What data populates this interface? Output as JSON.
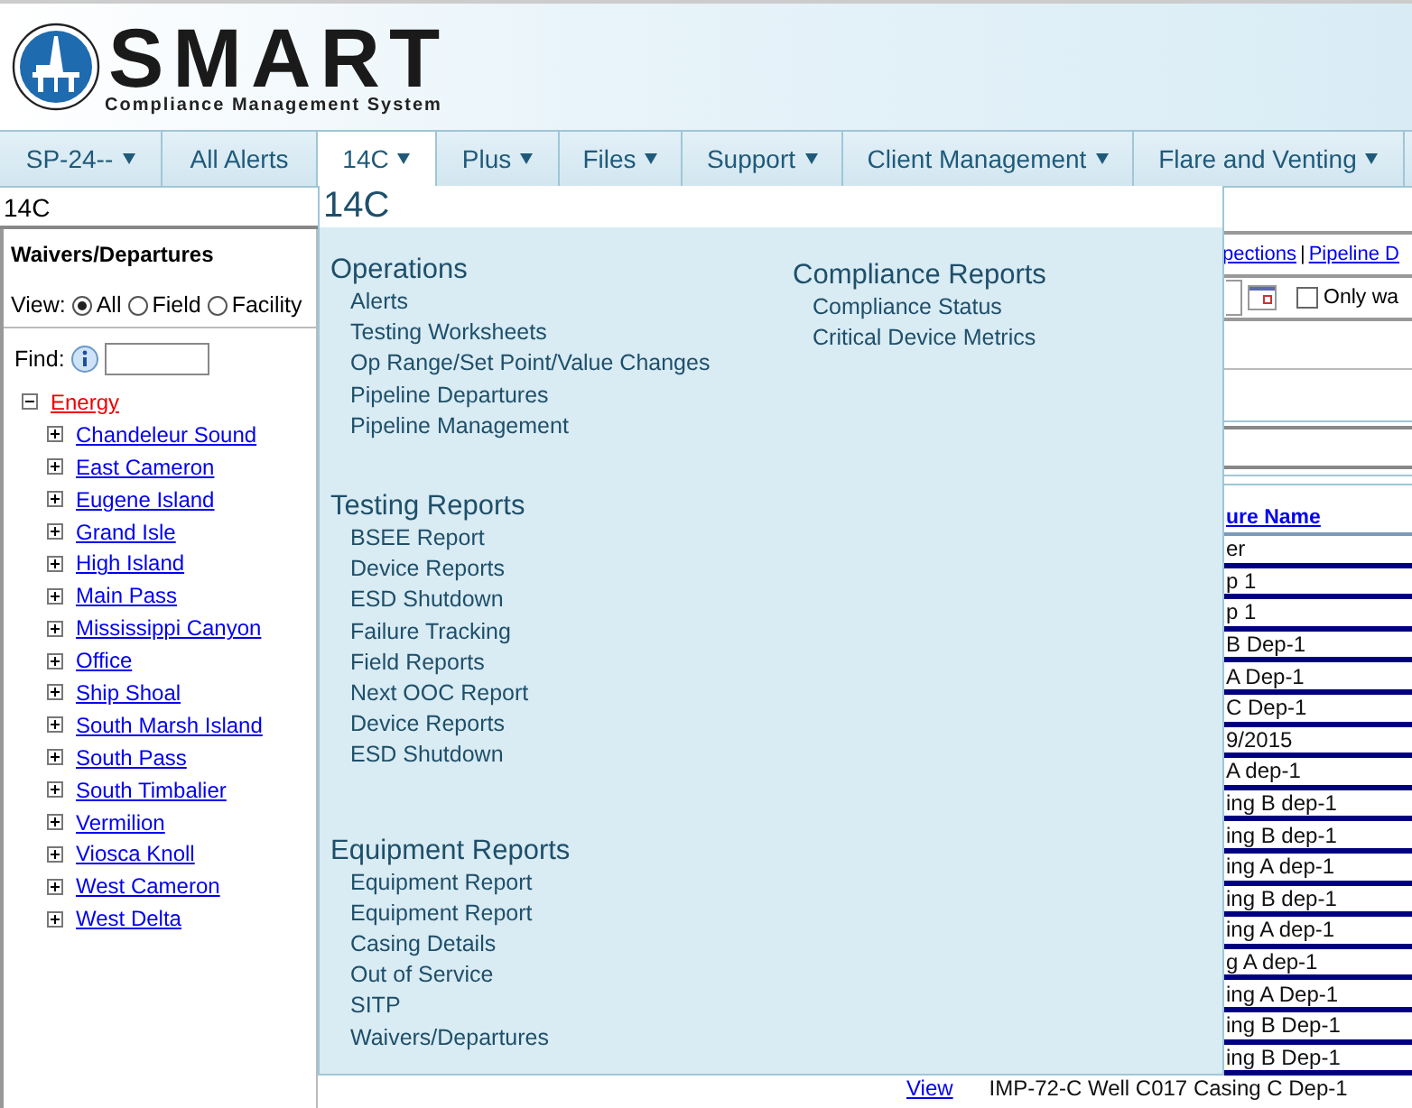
{
  "logo": {
    "title": "SMART",
    "subtitle": "Compliance Management System"
  },
  "nav": [
    {
      "label": "SP-24--",
      "dropdown": true,
      "selected": false
    },
    {
      "label": "All Alerts",
      "dropdown": false,
      "selected": false
    },
    {
      "label": "14C",
      "dropdown": true,
      "selected": true
    },
    {
      "label": "Plus",
      "dropdown": true,
      "selected": false
    },
    {
      "label": "Files",
      "dropdown": true,
      "selected": false
    },
    {
      "label": "Support",
      "dropdown": true,
      "selected": false
    },
    {
      "label": "Client Management",
      "dropdown": true,
      "selected": false
    },
    {
      "label": "Flare and Venting",
      "dropdown": true,
      "selected": false
    }
  ],
  "breadcrumb": "14C",
  "sidebar": {
    "title": "Waivers/Departures",
    "view_label": "View:",
    "view_options": [
      {
        "label": "All",
        "selected": true
      },
      {
        "label": "Field",
        "selected": false
      },
      {
        "label": "Facility",
        "selected": false
      }
    ],
    "find_label": "Find:",
    "tree": [
      {
        "label": "Energy",
        "expanded": true,
        "selected": true,
        "children": [
          {
            "label": "Chandeleur Sound",
            "expanded": false,
            "selected": false
          },
          {
            "label": "East Cameron",
            "expanded": false,
            "selected": false
          },
          {
            "label": "Eugene Island",
            "expanded": false,
            "selected": false
          },
          {
            "label": "Grand Isle",
            "expanded": false,
            "selected": false
          },
          {
            "label": "High Island",
            "expanded": false,
            "selected": false
          },
          {
            "label": "Main Pass",
            "expanded": false,
            "selected": false
          },
          {
            "label": "Mississippi Canyon",
            "expanded": false,
            "selected": false
          },
          {
            "label": "Office",
            "expanded": false,
            "selected": false
          },
          {
            "label": "Ship Shoal",
            "expanded": false,
            "selected": false
          },
          {
            "label": "South Marsh Island",
            "expanded": false,
            "selected": false
          },
          {
            "label": "South Pass",
            "expanded": false,
            "selected": false
          },
          {
            "label": "South Timbalier",
            "expanded": false,
            "selected": false
          },
          {
            "label": "Vermilion",
            "expanded": false,
            "selected": false
          },
          {
            "label": "Viosca Knoll",
            "expanded": false,
            "selected": false
          },
          {
            "label": "West Cameron",
            "expanded": false,
            "selected": false
          },
          {
            "label": "West Delta",
            "expanded": false,
            "selected": false
          }
        ]
      }
    ]
  },
  "menu": {
    "title": "14C",
    "columns": [
      [
        {
          "heading": "Operations",
          "items": [
            "Alerts",
            "Testing Worksheets",
            "Op Range/Set Point/Value Changes",
            "Pipeline Departures",
            "Pipeline Management"
          ]
        },
        {
          "heading": "Testing Reports",
          "items": [
            "BSEE Report",
            "Device Reports",
            "ESD Shutdown",
            "Failure Tracking",
            "Field Reports",
            "Next OOC Report",
            "Device Reports",
            "ESD Shutdown"
          ]
        },
        {
          "heading": "Equipment Reports",
          "items": [
            "Equipment Report",
            "Equipment Report",
            "Casing Details",
            "Out of Service",
            "SITP",
            "Waivers/Departures"
          ]
        }
      ],
      [
        {
          "heading": "Compliance Reports",
          "items": [
            "Compliance Status",
            "Critical Device Metrics"
          ]
        }
      ]
    ]
  },
  "content": {
    "links": [
      "pections",
      "Pipeline D"
    ],
    "link_separator": "|",
    "only_checkbox": {
      "label": "Only wa",
      "checked": false
    },
    "table": {
      "column_header": "ure Name",
      "rows": [
        "er",
        "p 1",
        "p 1",
        "B Dep-1",
        "A Dep-1",
        "C Dep-1",
        "9/2015",
        "A dep-1",
        "ing B dep-1",
        "ing B dep-1",
        "ing A dep-1",
        "ing B dep-1",
        "ing A dep-1",
        "g A dep-1",
        "ing A Dep-1",
        "ing B Dep-1",
        "ing B Dep-1"
      ],
      "last_row": {
        "link": "View",
        "text": "IMP-72-C Well C017 Casing C Dep-1"
      }
    }
  }
}
